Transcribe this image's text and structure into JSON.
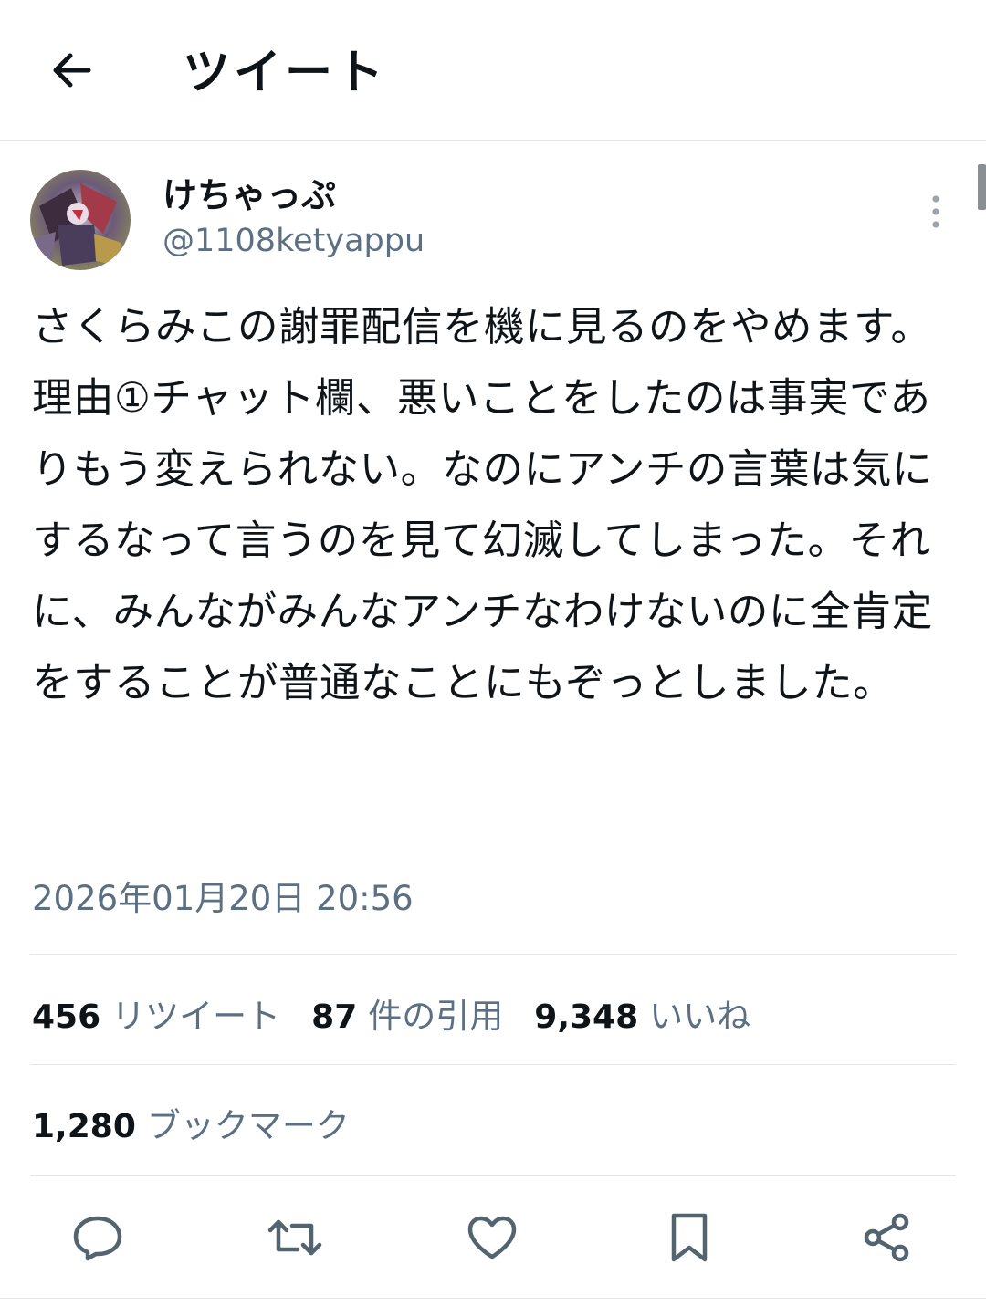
{
  "header": {
    "title": "ツイート",
    "back_icon": "arrow-left-icon"
  },
  "author": {
    "display_name": "けちゃっぷ",
    "handle": "@1108ketyappu",
    "avatar": "avatar-image",
    "more_icon": "more-vertical-icon"
  },
  "tweet": {
    "text": "さくらみこの謝罪配信を機に見るのをやめます。\n理由①チャット欄、悪いことをしたのは事実でありもう変えられない。なのにアンチの言葉は気にするなって言うのを見て幻滅してしまった。それに、みんながみんなアンチなわけないのに全肯定をすることが普通なことにもぞっとしました。",
    "timestamp": "2026年01月20日 20:56"
  },
  "stats": {
    "retweets_count": "456",
    "retweets_label": "リツイート",
    "quotes_count": "87",
    "quotes_label": "件の引用",
    "likes_count": "9,348",
    "likes_label": "いいね",
    "bookmarks_count": "1,280",
    "bookmarks_label": "ブックマーク"
  },
  "actions": {
    "icons": [
      "reply-icon",
      "retweet-icon",
      "like-icon",
      "bookmark-icon",
      "share-icon"
    ]
  },
  "colors": {
    "text": "#0f1419",
    "secondary": "#5b7083",
    "divider": "#e3e6e9",
    "icon": "#536471"
  }
}
